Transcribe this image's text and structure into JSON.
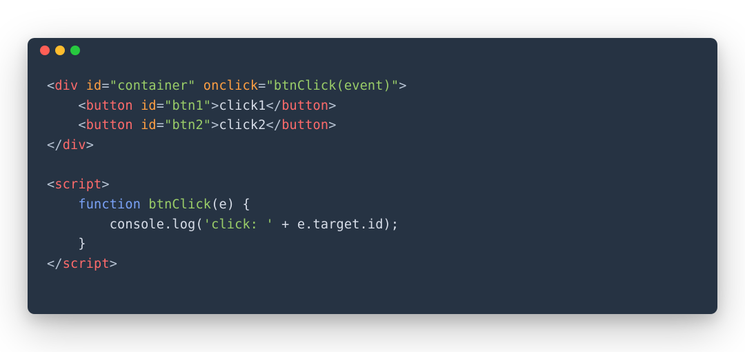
{
  "code": {
    "line1": {
      "open": "<",
      "tag": "div",
      "sp1": " ",
      "attr1": "id",
      "eq1": "=",
      "val1": "\"container\"",
      "sp2": " ",
      "attr2": "onclick",
      "eq2": "=",
      "val2": "\"btnClick(event)\"",
      "close": ">"
    },
    "line2": {
      "indent": "    ",
      "open": "<",
      "tag": "button",
      "sp1": " ",
      "attr1": "id",
      "eq1": "=",
      "val1": "\"btn1\"",
      "close": ">",
      "text": "click1",
      "openc": "</",
      "tagc": "button",
      "closec": ">"
    },
    "line3": {
      "indent": "    ",
      "open": "<",
      "tag": "button",
      "sp1": " ",
      "attr1": "id",
      "eq1": "=",
      "val1": "\"btn2\"",
      "close": ">",
      "text": "click2",
      "openc": "</",
      "tagc": "button",
      "closec": ">"
    },
    "line4": {
      "open": "</",
      "tag": "div",
      "close": ">"
    },
    "line5": {
      "open": "<",
      "tag": "script",
      "close": ">"
    },
    "line6": {
      "indent": "    ",
      "kw": "function",
      "sp": " ",
      "fn": "btnClick",
      "rest": "(e) {"
    },
    "line7": {
      "indent": "        ",
      "call": "console.log(",
      "str": "'click: '",
      "rest": " + e.target.id);"
    },
    "line8": {
      "indent": "    ",
      "brace": "}"
    },
    "line9": {
      "open": "</",
      "tag": "script",
      "close": ">"
    }
  }
}
